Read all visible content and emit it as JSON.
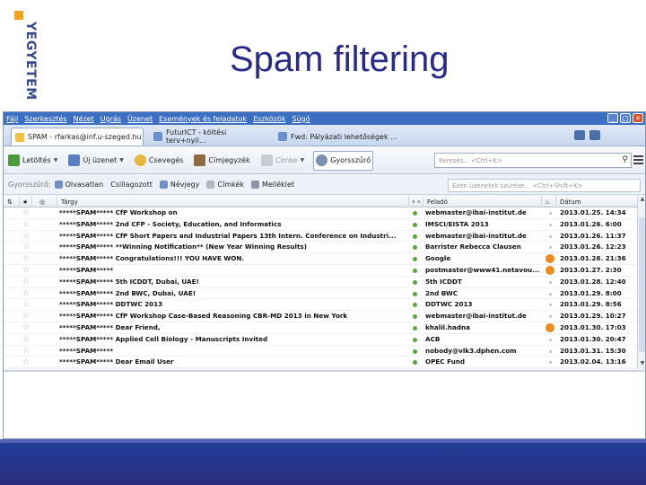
{
  "slide": {
    "title": "Spam filtering",
    "logo_text": "YEGYETEM"
  },
  "menubar": {
    "items": [
      "Fájl",
      "Szerkesztés",
      "Nézet",
      "Ugrás",
      "Üzenet",
      "Események és feladatok",
      "Eszközök",
      "Súgó"
    ]
  },
  "tabs": [
    {
      "label": "SPAM - rfarkas@inf.u-szeged.hu",
      "active": true
    },
    {
      "label": "FuturICT - költési terv+nyil...",
      "active": false
    },
    {
      "label": "Fwd: Pályázati lehetőségek ...",
      "active": false
    }
  ],
  "toolbar": {
    "buttons": [
      {
        "label": "Letöltés",
        "icon": "get-mail-icon",
        "dropdown": true
      },
      {
        "label": "Új üzenet",
        "icon": "write-icon",
        "dropdown": true
      },
      {
        "label": "Csevegés",
        "icon": "chat-icon",
        "dropdown": false
      },
      {
        "label": "Címjegyzék",
        "icon": "address-book-icon",
        "dropdown": false
      },
      {
        "label": "Címke",
        "icon": "tag-icon",
        "dropdown": true
      },
      {
        "label": "Gyorsszűrő",
        "icon": "quick-filter-icon",
        "dropdown": false
      }
    ],
    "search_placeholder": "Keresés... <Ctrl+K>"
  },
  "quickfilter": {
    "label": "Gyorsszűrő:",
    "items": [
      "Olvasatlan",
      "Csillagozott",
      "Névjegy",
      "Címkék",
      "Melléklet"
    ],
    "filter_placeholder": "Ezen üzenetek szűrése... <Ctrl+Shift+K>"
  },
  "columns": {
    "subject": "Tárgy",
    "sender": "Feladó",
    "date": "Dátum"
  },
  "messages": [
    {
      "subject": "*****SPAM***** CfP Workshop on",
      "sender": "webmaster@ibai-institut.de",
      "junk": false,
      "date": "2013.01.25. 14:34"
    },
    {
      "subject": "*****SPAM***** 2nd CFP - Society, Education, and Informatics",
      "sender": "IMSCI/EISTA 2013",
      "junk": false,
      "date": "2013.01.26. 6:00"
    },
    {
      "subject": "*****SPAM***** CfP Short Papers and Industrial Papers 13th Intern. Conference on Industri...",
      "sender": "webmaster@ibai-institut.de",
      "junk": false,
      "date": "2013.01.26. 11:37"
    },
    {
      "subject": "*****SPAM***** **Winning Notification** (New Year Winning Results)",
      "sender": "Barrister Rebecca Clausen",
      "junk": false,
      "date": "2013.01.26. 12:23"
    },
    {
      "subject": "*****SPAM***** Congratulations!!! YOU HAVE WON.",
      "sender": "Google",
      "junk": true,
      "date": "2013.01.26. 21:36"
    },
    {
      "subject": "*****SPAM*****",
      "sender": "postmaster@www41.netavou...",
      "junk": true,
      "date": "2013.01.27. 2:30"
    },
    {
      "subject": "*****SPAM***** 5th ICDDT, Dubai, UAE!",
      "sender": "5th ICDDT",
      "junk": false,
      "date": "2013.01.28. 12:40"
    },
    {
      "subject": "*****SPAM***** 2nd BWC, Dubai, UAE!",
      "sender": "2nd BWC",
      "junk": false,
      "date": "2013.01.29. 8:00"
    },
    {
      "subject": "*****SPAM***** DDTWC 2013",
      "sender": "DDTWC 2013",
      "junk": false,
      "date": "2013.01.29. 8:56"
    },
    {
      "subject": "*****SPAM***** CfP Workshop Case-Based Reasoning CBR-MD 2013 in New York",
      "sender": "webmaster@ibai-institut.de",
      "junk": false,
      "date": "2013.01.29. 10:27"
    },
    {
      "subject": "*****SPAM***** Dear Friend,",
      "sender": "khalil.hadna",
      "junk": true,
      "date": "2013.01.30. 17:03"
    },
    {
      "subject": "*****SPAM***** Applied Cell Biology - Manuscripts Invited",
      "sender": "ACB",
      "junk": false,
      "date": "2013.01.30. 20:47"
    },
    {
      "subject": "*****SPAM*****",
      "sender": "nobody@vlk3.dphen.com",
      "junk": false,
      "date": "2013.01.31. 15:30"
    },
    {
      "subject": "*****SPAM***** Dear Email User",
      "sender": "OPEC Fund",
      "junk": false,
      "date": "2013.02.04. 13:16"
    }
  ],
  "colors": {
    "title": "#2a2a8a",
    "menubar": "#3b6fc3",
    "footer": "#26348a",
    "junk_flag": "#f08a1c",
    "read_dot": "#57a83a"
  }
}
